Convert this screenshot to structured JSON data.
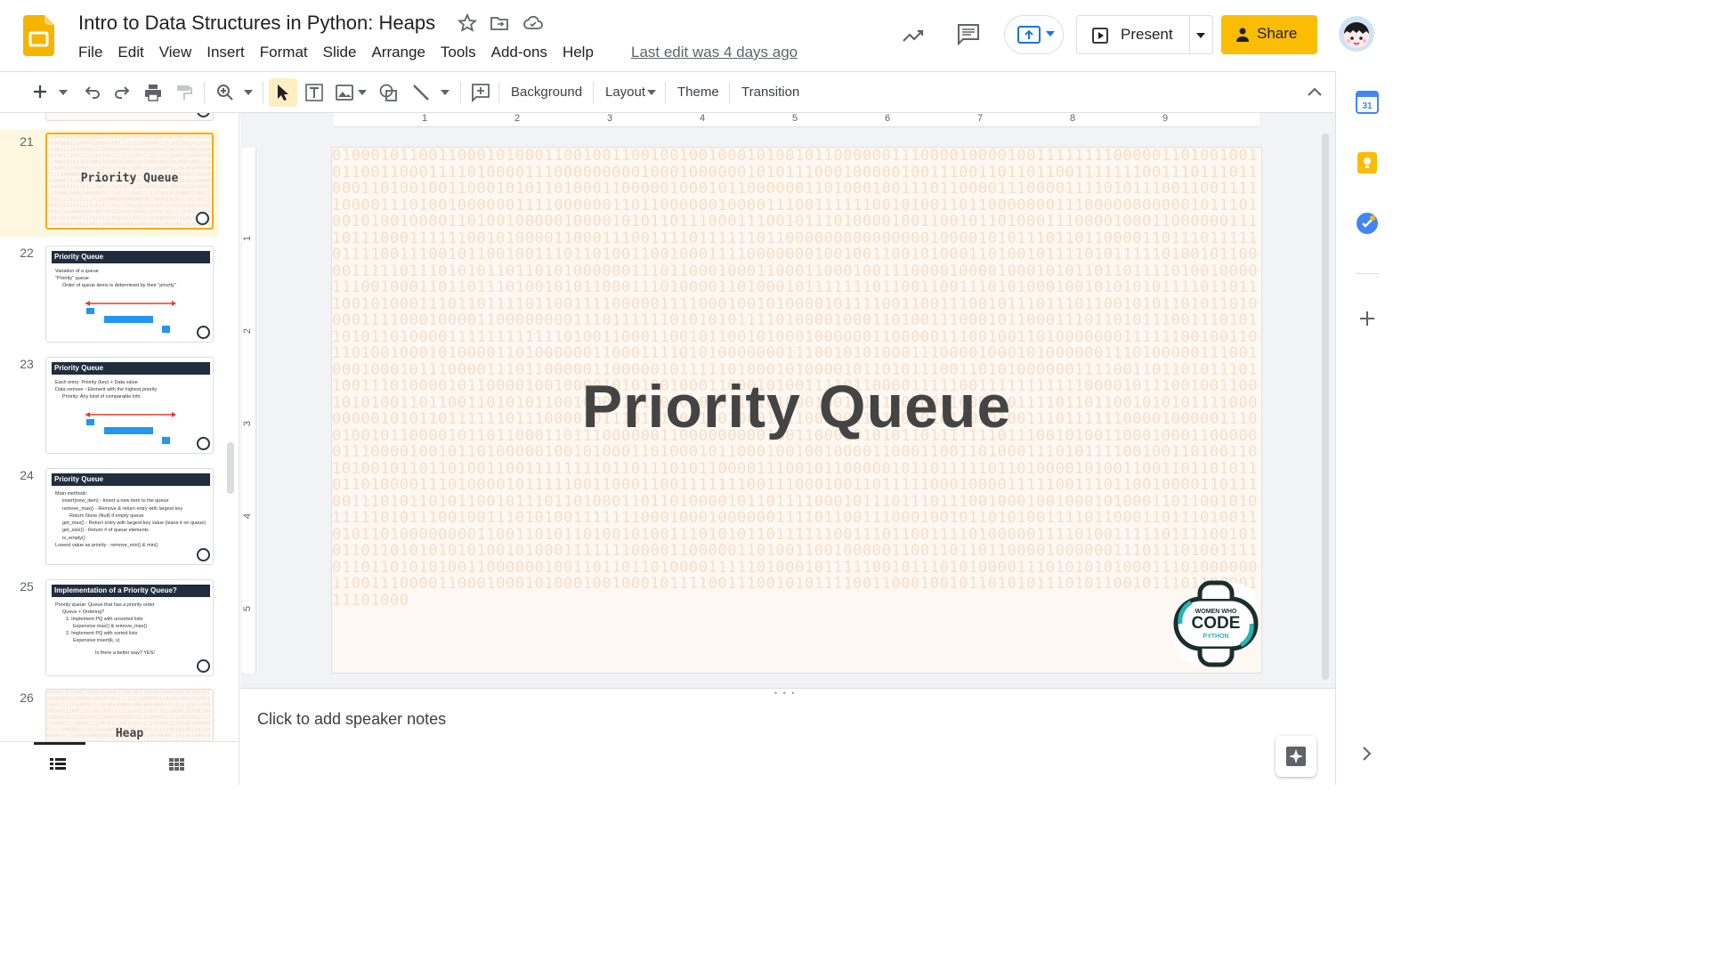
{
  "header": {
    "title": "Intro to Data Structures in Python: Heaps",
    "menu": [
      "File",
      "Edit",
      "View",
      "Insert",
      "Format",
      "Slide",
      "Arrange",
      "Tools",
      "Add-ons",
      "Help"
    ],
    "last_edit": "Last edit was 4 days ago",
    "present_label": "Present",
    "share_label": "Share"
  },
  "toolbar": {
    "background": "Background",
    "layout": "Layout",
    "theme": "Theme",
    "transition": "Transition"
  },
  "filmstrip": {
    "slides": [
      {
        "num": "21",
        "title": "Priority Queue"
      },
      {
        "num": "22",
        "title": "Priority Queue",
        "bullets": [
          "Variation of a queue",
          "\"Priority\" queue",
          "Order of queue items is determined by their \"priority\""
        ],
        "labels": {
          "low": "Low",
          "priority": "Priority",
          "high": "High",
          "back": "back",
          "front": "front",
          "enqueue": "enqueue",
          "dequeue": "dequeue",
          "cells": [
            "5",
            "6",
            "4",
            "3",
            "2"
          ],
          "in_val": "7",
          "out_val": "1"
        }
      },
      {
        "num": "23",
        "title": "Priority Queue",
        "bullets": [
          "Each entry: Priority (key) + Data value",
          "Data remove - Element with the highest priority",
          "Priority: Any kind of comparable info"
        ],
        "labels": {
          "low": "Low",
          "priority": "Priority",
          "high": "High",
          "back": "back",
          "front": "front",
          "enqueue": "enqueue",
          "dequeue": "dequeue",
          "cells": [
            "6",
            "5",
            "4",
            "3",
            "2"
          ],
          "in_val": "7",
          "out_val": "1"
        }
      },
      {
        "num": "24",
        "title": "Priority Queue",
        "bullets": [
          "Main methods:",
          "insert(new_item) - Insert a new item to the queue",
          "remove_max() - Remove & return entry with largest key",
          "Return None (Null) if empty queue",
          "get_max() - Return entry with largest key value (leave it on queue)",
          "get_size() - Return # of queue elements",
          "is_empty()",
          "Lowest value as priority - remove_min() & min()"
        ]
      },
      {
        "num": "25",
        "title": "Implementation of a Priority Queue?",
        "bullets": [
          "Priority queue: Queue that has a priority order",
          "Queue + Ordering?",
          "1. Implement PQ with unsorted lists",
          "Expensive max() & remove_max()",
          "2. Implement PQ with sorted lists",
          "Expensive insert(k, v)",
          "Is there a better way? YES!"
        ]
      },
      {
        "num": "26",
        "title": "Heap"
      }
    ]
  },
  "slide": {
    "title": "Priority Queue",
    "logo_lines": [
      "WOMEN WHO",
      "CODE",
      "PYTHON"
    ]
  },
  "ruler": {
    "h": [
      "1",
      "2",
      "3",
      "4",
      "5",
      "6",
      "7",
      "8",
      "9"
    ],
    "v": [
      "1",
      "2",
      "3",
      "4",
      "5"
    ]
  },
  "notes": {
    "placeholder": "Click to add speaker notes"
  },
  "colors": {
    "accent": "#fbbc04",
    "selected_border": "#f9ab00",
    "slide_header": "#1f2d3d"
  }
}
